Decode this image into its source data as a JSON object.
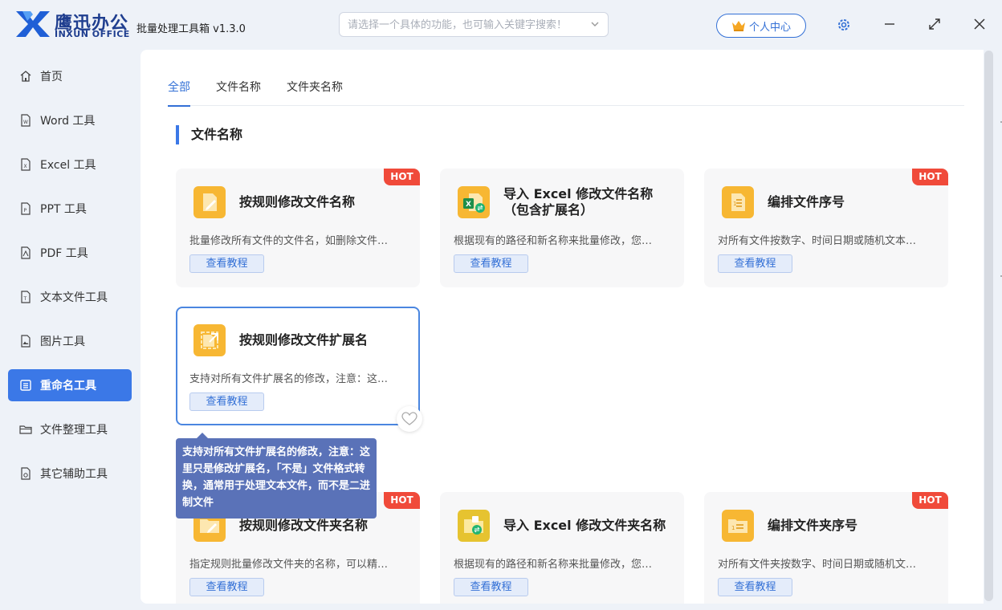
{
  "brand": {
    "name_cn": "鹰迅办公",
    "name_en": "INXUN OFFICE"
  },
  "app_title": "批量处理工具箱 v1.3.0",
  "search": {
    "placeholder": "请选择一个具体的功能，也可输入关键字搜索！"
  },
  "header": {
    "user_center_label": "个人中心"
  },
  "sidebar": {
    "items": [
      {
        "label": "首页",
        "icon": "home-icon"
      },
      {
        "label": "Word 工具",
        "icon": "word-file-icon"
      },
      {
        "label": "Excel 工具",
        "icon": "excel-file-icon"
      },
      {
        "label": "PPT 工具",
        "icon": "ppt-file-icon"
      },
      {
        "label": "PDF 工具",
        "icon": "pdf-file-icon"
      },
      {
        "label": "文本文件工具",
        "icon": "text-file-icon"
      },
      {
        "label": "图片工具",
        "icon": "image-file-icon"
      },
      {
        "label": "重命名工具",
        "icon": "rename-list-icon",
        "active": true
      },
      {
        "label": "文件整理工具",
        "icon": "folder-icon"
      },
      {
        "label": "其它辅助工具",
        "icon": "tool-file-icon"
      }
    ]
  },
  "tabs": [
    {
      "label": "全部",
      "active": true
    },
    {
      "label": "文件名称"
    },
    {
      "label": "文件夹名称"
    }
  ],
  "section": {
    "title": "文件名称"
  },
  "cards": [
    {
      "title": "按规则修改文件名称",
      "desc": "批量修改所有文件的文件名，如删除文件…",
      "tutorial": "查看教程",
      "hot": "HOT"
    },
    {
      "title": "导入 Excel 修改文件名称（包含扩展名）",
      "desc": "根据现有的路径和新名称来批量修改，您…",
      "tutorial": "查看教程"
    },
    {
      "title": "编排文件序号",
      "desc": "对所有文件按数字、时间日期或随机文本…",
      "tutorial": "查看教程",
      "hot": "HOT"
    },
    {
      "title": "按规则修改文件扩展名",
      "desc": "支持对所有文件扩展名的修改，注意：这…",
      "tutorial": "查看教程"
    },
    {
      "title": "按规则修改文件夹名称",
      "desc": "指定规则批量修改文件夹的名称，可以精…",
      "tutorial": "查看教程",
      "hot": "HOT"
    },
    {
      "title": "导入 Excel 修改文件夹名称",
      "desc": "根据现有的路径和新名称来批量修改，您…",
      "tutorial": "查看教程"
    },
    {
      "title": "编排文件夹序号",
      "desc": "对所有文件夹按数字、时间日期或随机文…",
      "tutorial": "查看教程",
      "hot": "HOT"
    }
  ],
  "tooltip": {
    "text": "支持对所有文件扩展名的修改，注意：这里只是修改扩展名，「不是」文件格式转换，通常用于处理文本文件，而不是二进制文件"
  },
  "colors": {
    "accent": "#3370d6",
    "sidebar_active": "#3b78e7",
    "hot": "#f04a3a",
    "icon_orange": "#f7b733",
    "tooltip": "#5a72b8"
  }
}
